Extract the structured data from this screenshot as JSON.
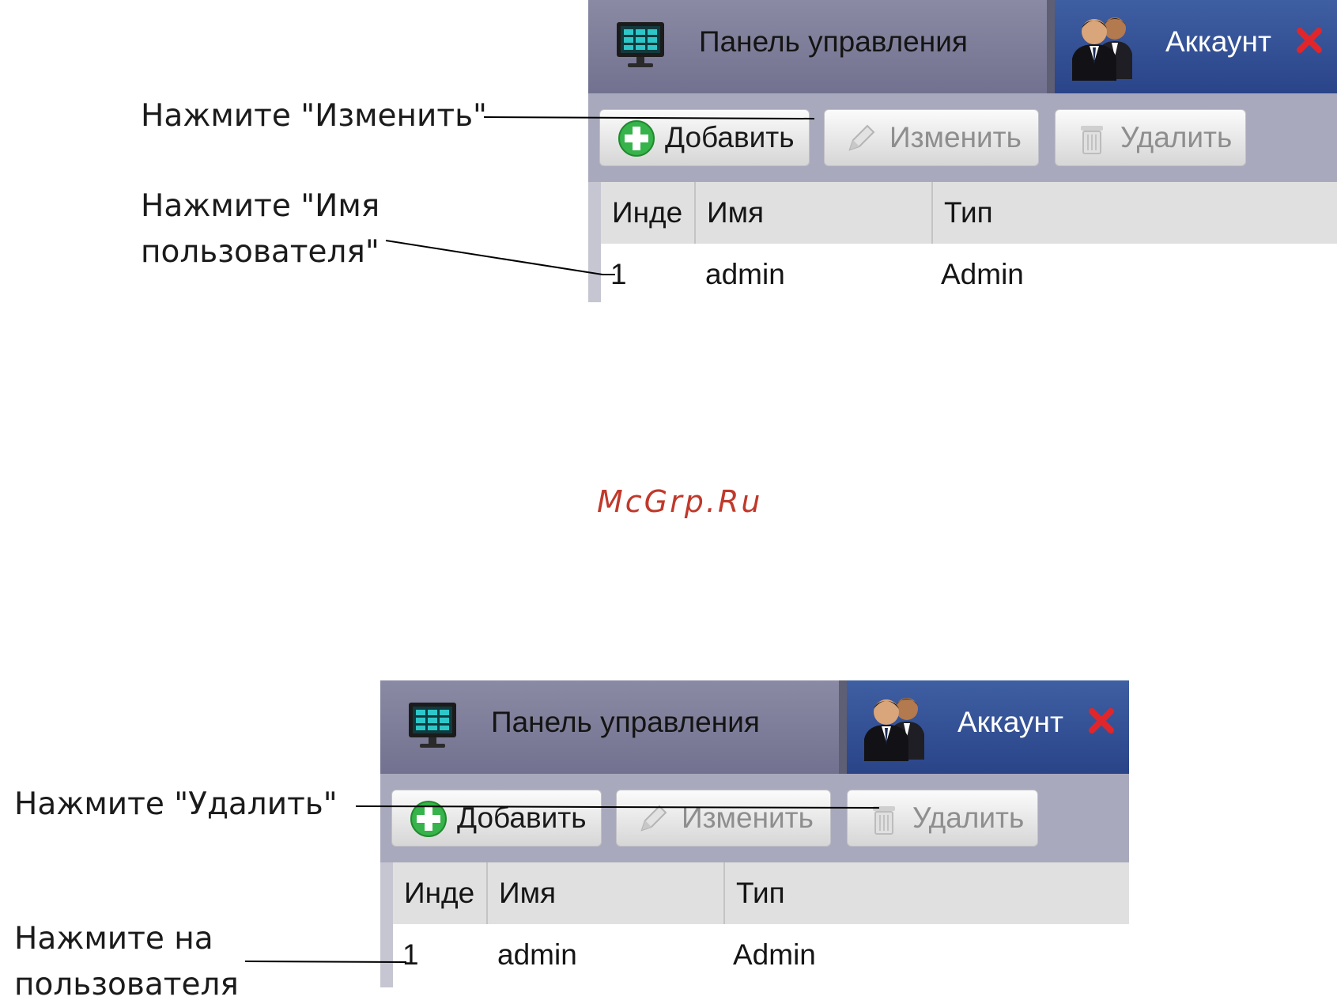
{
  "panel_top": {
    "tabs": {
      "control_panel": "Панель управления",
      "account": "Аккаунт"
    },
    "toolbar": {
      "add": "Добавить",
      "edit": "Изменить",
      "delete": "Удалить"
    },
    "table": {
      "headers": [
        "Инде",
        "Имя",
        "Тип"
      ],
      "rows": [
        {
          "index": "1",
          "name": "admin",
          "type": "Admin"
        }
      ]
    }
  },
  "panel_bottom": {
    "tabs": {
      "control_panel": "Панель управления",
      "account": "Аккаунт"
    },
    "toolbar": {
      "add": "Добавить",
      "edit": "Изменить",
      "delete": "Удалить"
    },
    "table": {
      "headers": [
        "Инде",
        "Имя",
        "Тип"
      ],
      "rows": [
        {
          "index": "1",
          "name": "admin",
          "type": "Admin"
        }
      ]
    }
  },
  "annotations": {
    "click_edit": "Нажмите \"Изменить\"",
    "click_username_1": "Нажмите \"Имя",
    "click_username_2": "пользователя\"",
    "click_delete": "Нажмите \"Удалить\"",
    "click_user_1": "Нажмите на",
    "click_user_2": "пользователя"
  },
  "watermark": "McGrp.Ru",
  "icons": {
    "monitor": "monitor-icon",
    "users": "users-icon",
    "close": "close-icon",
    "add": "plus-circle-icon",
    "edit": "pencil-icon",
    "delete": "trash-icon"
  },
  "colors": {
    "account_tab": "#2f4c92",
    "add_icon": "#36b34a",
    "close_icon": "#e0262b",
    "watermark": "#c0392b"
  }
}
